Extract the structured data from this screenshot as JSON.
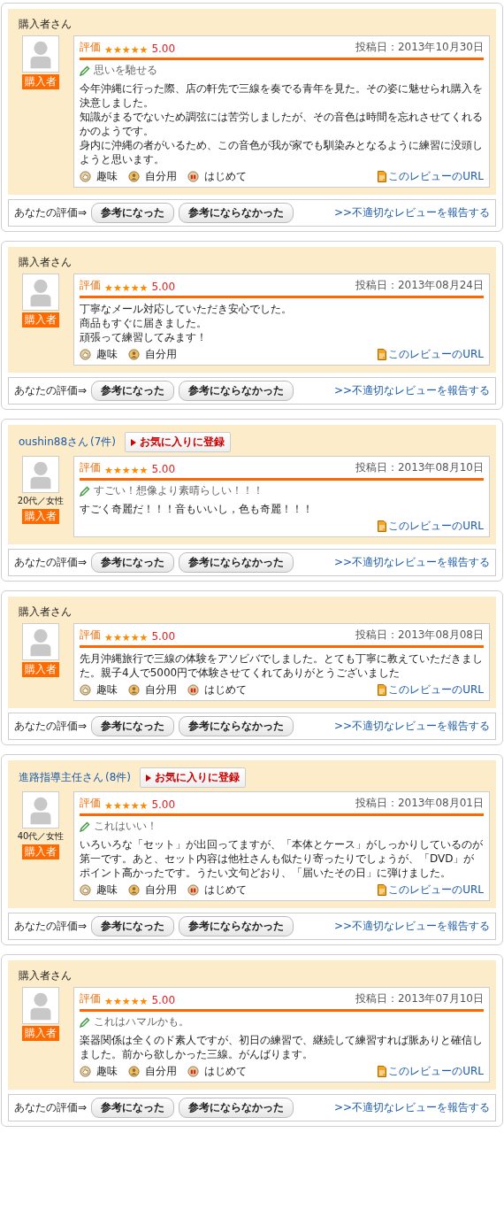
{
  "reviews": [
    {
      "reviewer": {
        "name": "購入者さん",
        "kind": "plain"
      },
      "badge": "購入者",
      "rating_label": "評価",
      "stars": 5,
      "score": "5.00",
      "date": "投稿日：2013年10月30日",
      "title": "思いを馳せる",
      "body": [
        "今年沖縄に行った際、店の軒先で三線を奏でる青年を見た。その姿に魅せられ購入を決意しました。",
        "知識がまるでないため調弦には苦労しましたが、その音色は時間を忘れさせてくれるかのようです。",
        "身内に沖縄の者がいるため、この音色が我が家でも馴染みとなるように練習に没頭しようと思います。"
      ],
      "tags": [
        {
          "kind": "hobby",
          "label": "趣味"
        },
        {
          "kind": "self",
          "label": "自分用"
        },
        {
          "kind": "first",
          "label": "はじめて"
        }
      ],
      "url": "このレビューのURL",
      "footer": {
        "label": "あなたの評価⇒",
        "buttons": [
          "参考になった",
          "参考にならなかった"
        ],
        "report": ">>不適切なレビューを報告する"
      }
    },
    {
      "reviewer": {
        "name": "購入者さん",
        "kind": "plain"
      },
      "badge": "購入者",
      "rating_label": "評価",
      "stars": 5,
      "score": "5.00",
      "date": "投稿日：2013年08月24日",
      "body": [
        "丁寧なメール対応していただき安心でした。",
        "商品もすぐに届きました。",
        "頑張って練習してみます！"
      ],
      "tags": [
        {
          "kind": "hobby",
          "label": "趣味"
        },
        {
          "kind": "self",
          "label": "自分用"
        }
      ],
      "url": "このレビューのURL",
      "footer": {
        "label": "あなたの評価⇒",
        "buttons": [
          "参考になった",
          "参考にならなかった"
        ],
        "report": ">>不適切なレビューを報告する"
      }
    },
    {
      "reviewer": {
        "name": "oushin88さん",
        "kind": "link",
        "count": "(7件)",
        "favorite": "お気に入りに登録"
      },
      "demographic": "20代／女性",
      "badge": "購入者",
      "rating_label": "評価",
      "stars": 5,
      "score": "5.00",
      "date": "投稿日：2013年08月10日",
      "title": "すごい！想像より素晴らしい！！！",
      "body": [
        "すごく奇麗だ！！！音もいいし，色も奇麗！！！"
      ],
      "url": "このレビューのURL",
      "footer": {
        "label": "あなたの評価⇒",
        "buttons": [
          "参考になった",
          "参考にならなかった"
        ],
        "report": ">>不適切なレビューを報告する"
      }
    },
    {
      "reviewer": {
        "name": "購入者さん",
        "kind": "plain"
      },
      "badge": "購入者",
      "rating_label": "評価",
      "stars": 5,
      "score": "5.00",
      "date": "投稿日：2013年08月08日",
      "body": [
        "先月沖縄旅行で三線の体験をアソビバでしました。とても丁寧に教えていただきました。親子4人で5000円で体験させてくれてありがとうございました"
      ],
      "tags": [
        {
          "kind": "hobby",
          "label": "趣味"
        },
        {
          "kind": "self",
          "label": "自分用"
        },
        {
          "kind": "first",
          "label": "はじめて"
        }
      ],
      "url": "このレビューのURL",
      "footer": {
        "label": "あなたの評価⇒",
        "buttons": [
          "参考になった",
          "参考にならなかった"
        ],
        "report": ">>不適切なレビューを報告する"
      }
    },
    {
      "reviewer": {
        "name": "進路指導主任さん",
        "kind": "link",
        "count": "(8件)",
        "favorite": "お気に入りに登録"
      },
      "demographic": "40代／女性",
      "badge": "購入者",
      "rating_label": "評価",
      "stars": 5,
      "score": "5.00",
      "date": "投稿日：2013年08月01日",
      "title": "これはいい！",
      "body": [
        "いろいろな「セット」が出回ってますが、「本体とケース」がしっかりしているのが第一です。あと、セット内容は他社さんも似たり寄ったりでしょうが、「DVD」がポイント高かったです。うたい文句どおり、「届いたその日」に弾けました。"
      ],
      "tags": [
        {
          "kind": "hobby",
          "label": "趣味"
        },
        {
          "kind": "self",
          "label": "自分用"
        },
        {
          "kind": "first",
          "label": "はじめて"
        }
      ],
      "url": "このレビューのURL",
      "footer": {
        "label": "あなたの評価⇒",
        "buttons": [
          "参考になった",
          "参考にならなかった"
        ],
        "report": ">>不適切なレビューを報告する"
      }
    },
    {
      "reviewer": {
        "name": "購入者さん",
        "kind": "plain"
      },
      "badge": "購入者",
      "rating_label": "評価",
      "stars": 5,
      "score": "5.00",
      "date": "投稿日：2013年07月10日",
      "title": "これはハマルかも。",
      "body": [
        "楽器関係は全くのド素人ですが、初日の練習で、継続して練習すれば脈ありと確信しました。前から欲しかった三線。がんばります。"
      ],
      "tags": [
        {
          "kind": "hobby",
          "label": "趣味"
        },
        {
          "kind": "self",
          "label": "自分用"
        },
        {
          "kind": "first",
          "label": "はじめて"
        }
      ],
      "url": "このレビューのURL",
      "footer": {
        "label": "あなたの評価⇒",
        "buttons": [
          "参考になった",
          "参考にならなかった"
        ],
        "report": ">>不適切なレビューを報告する"
      }
    }
  ]
}
